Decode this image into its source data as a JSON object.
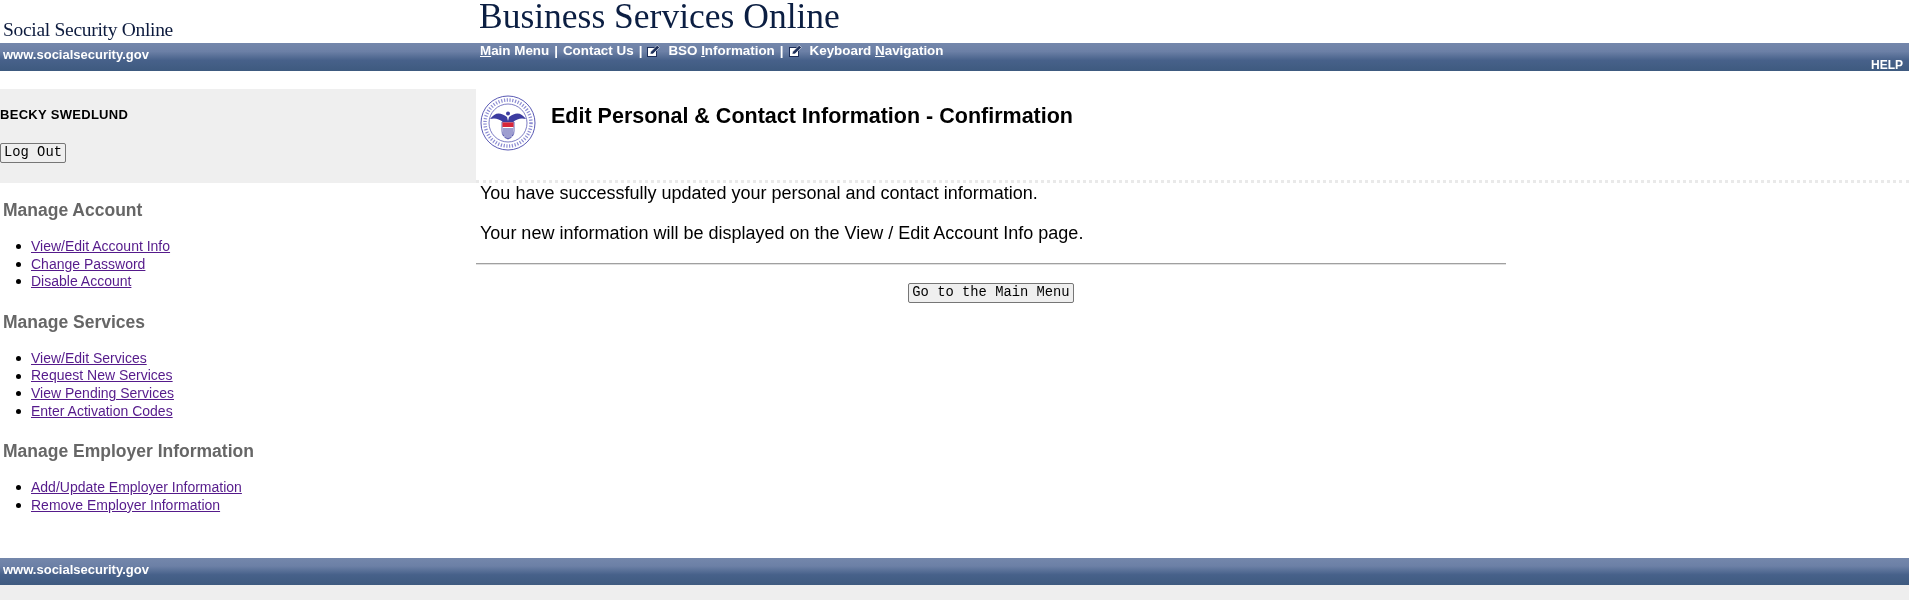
{
  "header": {
    "site_title": "Social Security Online",
    "app_title": "Business Services Online"
  },
  "top_bar": {
    "site_url": "www.socialsecurity.gov",
    "nav": [
      {
        "kind": "link",
        "access_key": "M",
        "text_after": "ain Menu"
      },
      {
        "kind": "separator",
        "text": "|"
      },
      {
        "kind": "link",
        "text_before": "Contact Us"
      },
      {
        "kind": "separator",
        "text": "|"
      },
      {
        "kind": "icon_link",
        "text_before": "BSO ",
        "access_key": "I",
        "text_after": "nformation"
      },
      {
        "kind": "separator",
        "text": "|"
      },
      {
        "kind": "icon_link",
        "text_before": "Keyboard ",
        "access_key": "N",
        "text_after": "avigation"
      }
    ],
    "help": "HELP"
  },
  "user_panel": {
    "name": "BECKY SWEDLUND",
    "logout_button": "Log Out"
  },
  "sidebar": {
    "sections": [
      {
        "title": "Manage Account",
        "links": [
          "View/Edit Account Info",
          "Change Password",
          "Disable Account"
        ]
      },
      {
        "title": "Manage Services",
        "links": [
          "View/Edit Services",
          "Request New Services",
          "View Pending Services",
          "Enter Activation Codes"
        ]
      },
      {
        "title": "Manage Employer Information",
        "links": [
          "Add/Update Employer Information",
          "Remove Employer Information"
        ]
      }
    ]
  },
  "page": {
    "title": "Edit Personal & Contact Information - Confirmation",
    "messages": [
      "You have successfully updated your personal and contact information.",
      "Your new information will be displayed on the View / Edit Account Info page."
    ],
    "main_menu_button": "Go to the Main Menu"
  },
  "footer": {
    "site_url": "www.socialsecurity.gov"
  }
}
